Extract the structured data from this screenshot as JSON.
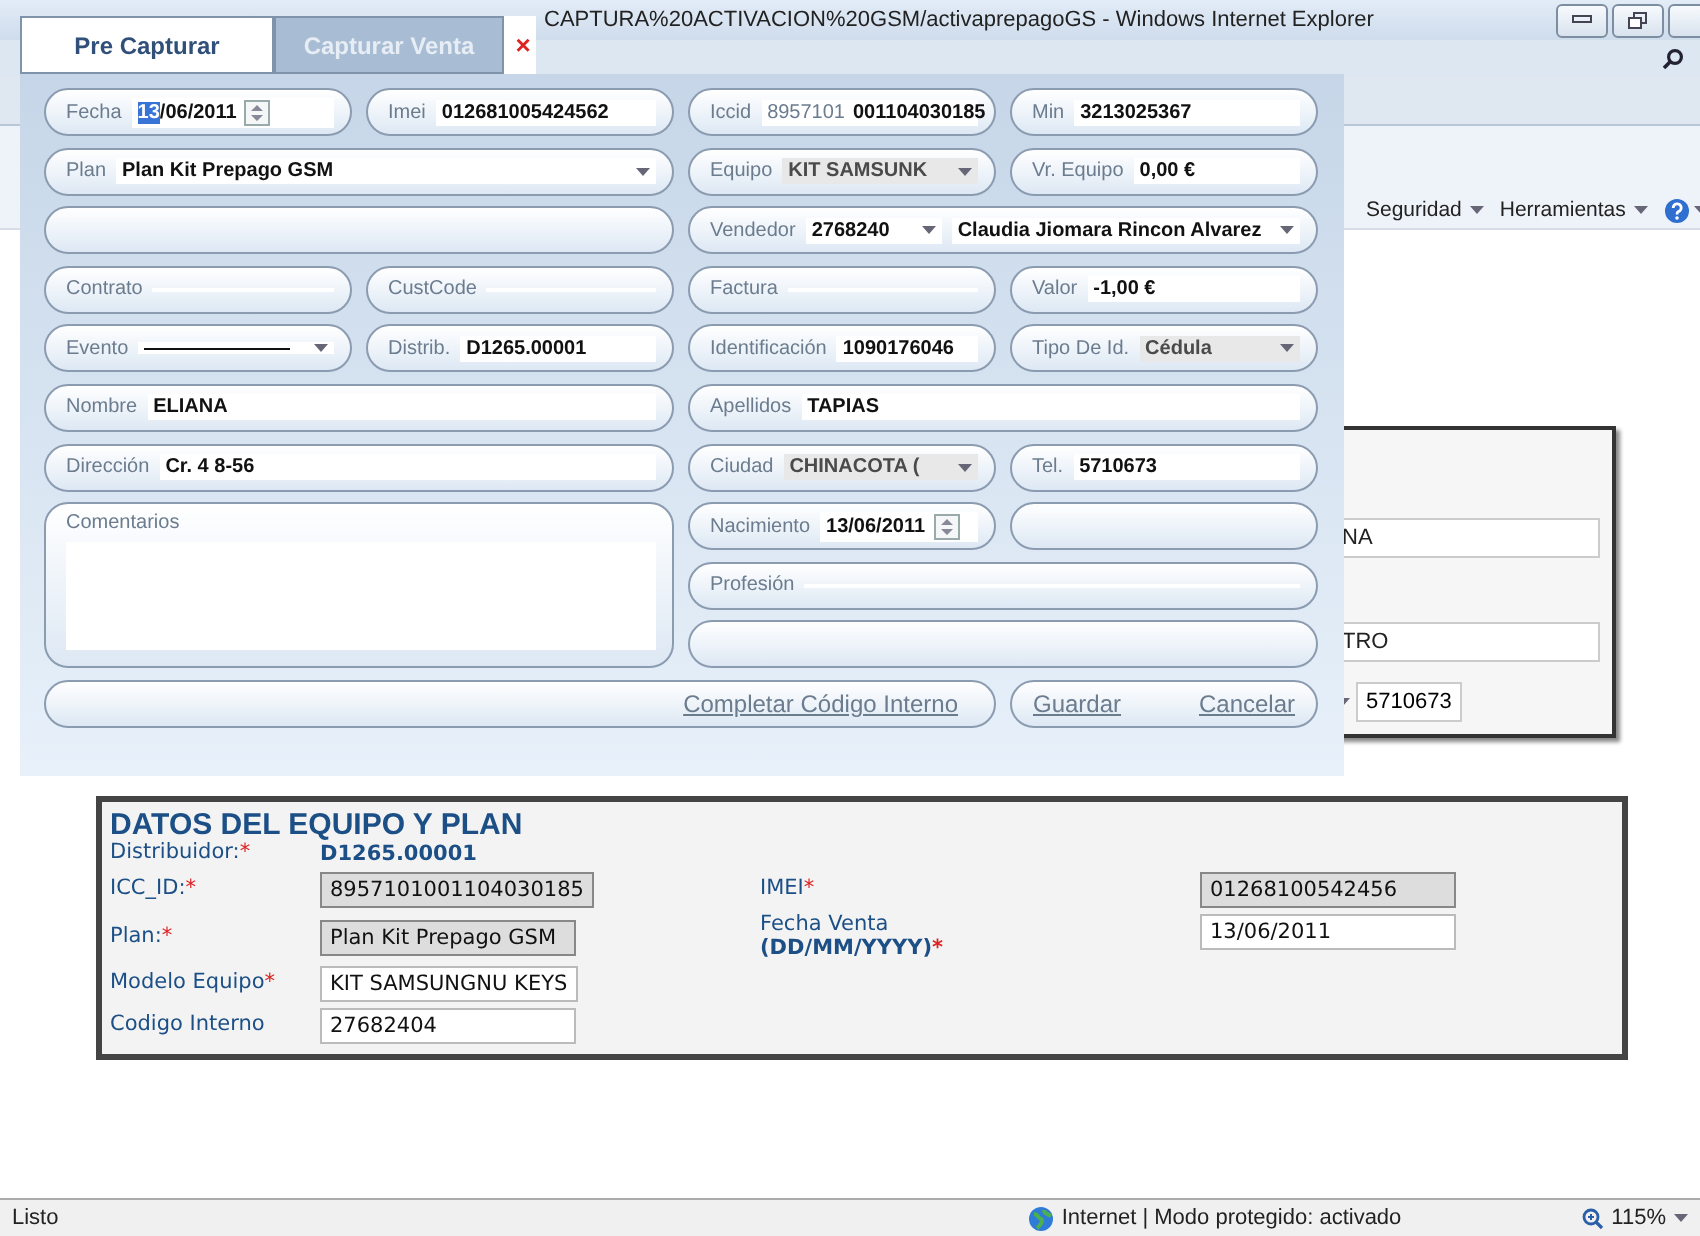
{
  "browser": {
    "title": "CAPTURA%20ACTIVACION%20GSM/activaprepagoGS - Windows Internet Explorer",
    "toolbar": [
      {
        "kind": "menu",
        "label": "Seguridad"
      },
      {
        "kind": "menu",
        "label": "Herramientas"
      },
      {
        "kind": "help"
      }
    ]
  },
  "form": {
    "tabs": [
      {
        "label": "Pre Capturar",
        "selected": true
      },
      {
        "label": "Capturar Venta",
        "selected": false
      }
    ],
    "close": "×",
    "fields": [
      {
        "kind": "date",
        "label": "Fecha",
        "value_selected": "13",
        "value": "/06/2011"
      },
      {
        "kind": "text",
        "label": "Imei",
        "value": "012681005424562"
      },
      {
        "kind": "text",
        "label": "Iccid",
        "prefix": "8957101",
        "value": "001104030185"
      },
      {
        "kind": "text",
        "label": "Min",
        "value": "3213025367"
      },
      {
        "kind": "select",
        "label": "Plan",
        "value": "Plan Kit Prepago GSM",
        "disabled": false
      },
      {
        "kind": "select",
        "label": "Equipo",
        "value": "KIT SAMSUNK",
        "disabled": true
      },
      {
        "kind": "text",
        "label": "Vr. Equipo",
        "value": "0,00 €"
      },
      {
        "kind": "blank"
      },
      {
        "kind": "vendor",
        "label": "Vendedor",
        "value": "2768240",
        "name": "Claudia Jiomara Rincon Alvarez"
      },
      {
        "kind": "text",
        "label": "Contrato"
      },
      {
        "kind": "text",
        "label": "CustCode"
      },
      {
        "kind": "text",
        "label": "Factura"
      },
      {
        "kind": "text",
        "label": "Valor",
        "value": "-1,00 €"
      },
      {
        "kind": "select",
        "label": "Evento",
        "disabled": false
      },
      {
        "kind": "text",
        "label": "Distrib.",
        "value": "D1265.00001"
      },
      {
        "kind": "text",
        "label": "Identificación",
        "value": "1090176046"
      },
      {
        "kind": "select",
        "label": "Tipo De Id.",
        "value": "Cédula",
        "disabled": true
      },
      {
        "kind": "text",
        "label": "Nombre",
        "value": "ELIANA"
      },
      {
        "kind": "text",
        "label": "Apellidos",
        "value": "TAPIAS"
      },
      {
        "kind": "text",
        "label": "Dirección",
        "value": "Cr. 4 8-56"
      },
      {
        "kind": "select",
        "label": "Ciudad",
        "value": "CHINACOTA (",
        "disabled": true
      },
      {
        "kind": "text",
        "label": "Tel.",
        "value": "5710673"
      },
      {
        "kind": "textarea",
        "label": "Comentarios"
      },
      {
        "kind": "date",
        "label": "Nacimiento",
        "value": "13/06/2011"
      },
      {
        "kind": "blank"
      },
      {
        "kind": "text",
        "label": "Profesión"
      },
      {
        "kind": "blank"
      },
      {
        "kind": "actions",
        "links": [
          "Completar Código Interno"
        ]
      },
      {
        "kind": "actions",
        "links": [
          "Guardar",
          "Cancelar"
        ]
      }
    ]
  },
  "behind_panel": {
    "fields": [
      "NA",
      "TRO"
    ],
    "phone": "5710673"
  },
  "equipment_panel": {
    "title": "DATOS DEL EQUIPO Y PLAN",
    "items": [
      {
        "kind": "static",
        "label": "Distribuidor:",
        "mark": "*",
        "value": "D1265.00001"
      },
      {
        "kind": "input",
        "label": "ICC_ID:",
        "mark": "*",
        "value": "8957101001104030185",
        "disabled": true
      },
      {
        "kind": "input",
        "label": "IMEI",
        "mark": "*",
        "value": "01268100542456",
        "disabled": true
      },
      {
        "kind": "input",
        "label": "Plan:",
        "mark": "*",
        "value": "Plan Kit Prepago GSM",
        "disabled": true
      },
      {
        "kind": "input",
        "label": "Fecha Venta",
        "sublabel": "(DD/MM/YYYY)",
        "mark": "*",
        "value": "13/06/2011",
        "disabled": false
      },
      {
        "kind": "input",
        "label": "Modelo Equipo",
        "mark": "*",
        "value": "KIT SAMSUNGNU KEYS",
        "disabled": false
      },
      {
        "kind": "input",
        "label": "Codigo Interno",
        "value": "27682404",
        "disabled": false
      }
    ]
  },
  "status_bar": {
    "text": "Listo",
    "zone": "Internet | Modo protegido: activado",
    "zoom": "115%"
  }
}
